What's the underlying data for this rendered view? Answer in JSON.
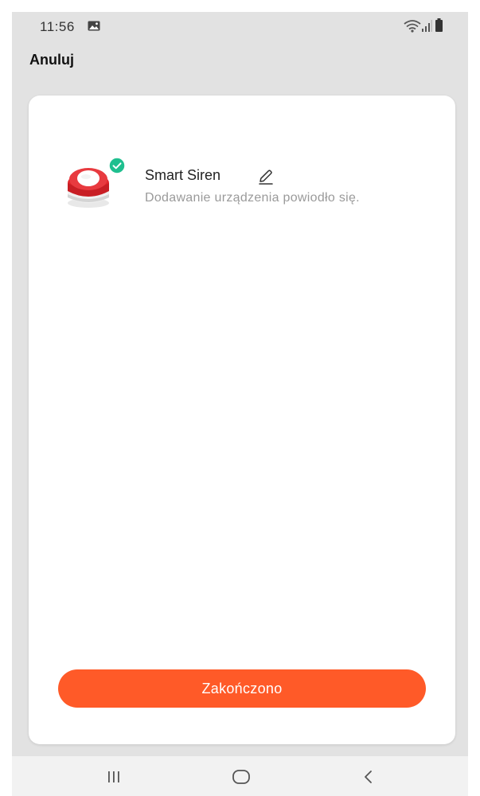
{
  "status_bar": {
    "time": "11:56"
  },
  "top_bar": {
    "cancel_label": "Anuluj"
  },
  "device": {
    "name": "Smart Siren",
    "status": "Dodawanie urządzenia powiodło się.",
    "image_icon": "siren-device-image",
    "badge_icon": "check-badge-icon",
    "edit_icon": "pencil-icon"
  },
  "actions": {
    "done_label": "Zakończono"
  },
  "colors": {
    "accent": "#ff5a28",
    "success": "#1fbf8f",
    "background": "#e2e2e2",
    "card": "#ffffff"
  }
}
